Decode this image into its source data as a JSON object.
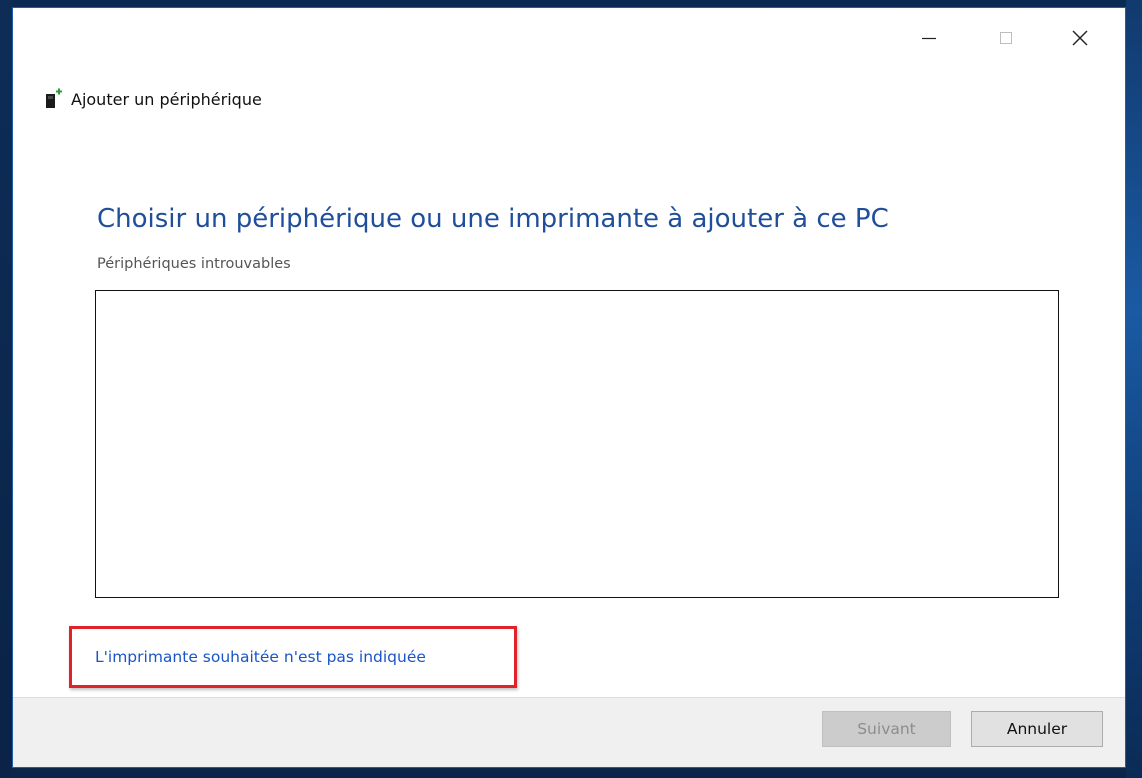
{
  "window": {
    "title": "Ajouter un périphérique",
    "controls": {
      "minimize": "minimize-icon",
      "maximize": "maximize-icon",
      "close": "close-icon"
    }
  },
  "main": {
    "heading": "Choisir un périphérique ou une imprimante à ajouter à ce PC",
    "status": "Périphériques introuvables",
    "link": "L'imprimante souhaitée n'est pas indiquée"
  },
  "footer": {
    "next_label": "Suivant",
    "cancel_label": "Annuler"
  },
  "colors": {
    "heading": "#1f4e9b",
    "link": "#1a55c7",
    "highlight": "#e0232b",
    "footer_bg": "#f0f0f0"
  }
}
